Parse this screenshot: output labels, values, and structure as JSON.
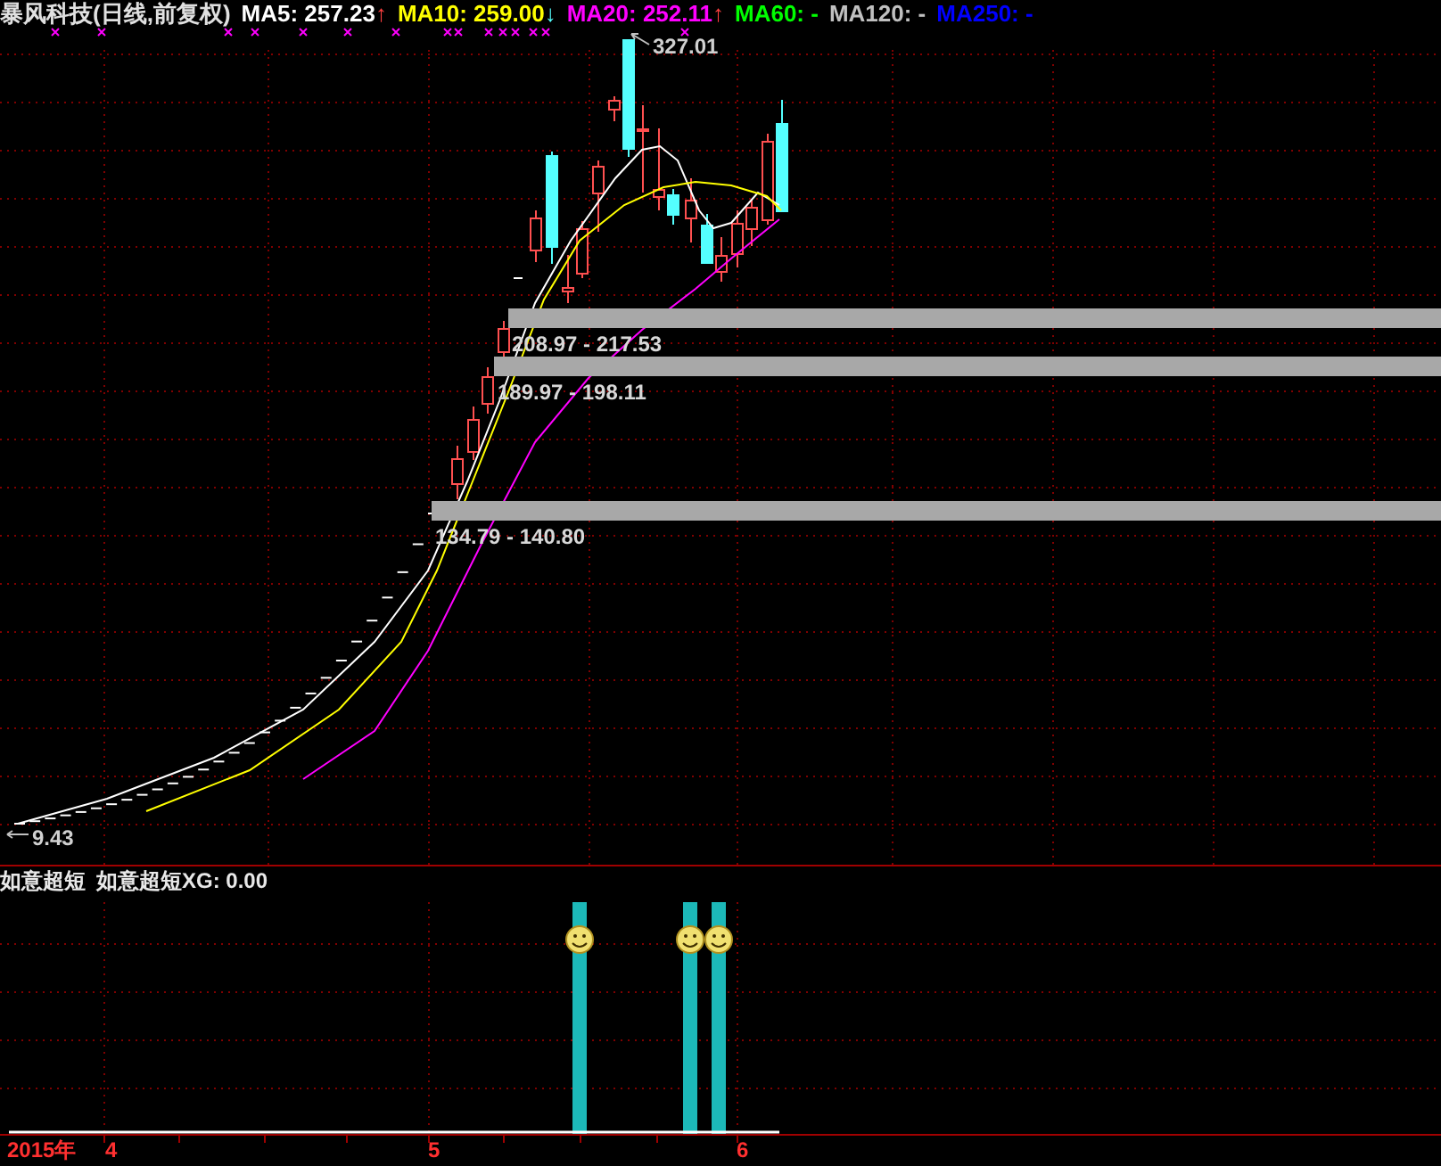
{
  "header": {
    "title": "暴风科技(日线,前复权)",
    "ma": [
      {
        "label": "MA5: 257.23",
        "color": "#ffffff",
        "arrow": {
          "text": "↑",
          "color": "#ff4040"
        }
      },
      {
        "label": "MA10: 259.00",
        "color": "#ffff00",
        "arrow": {
          "text": "↓",
          "color": "#54ffff"
        }
      },
      {
        "label": "MA20: 252.11",
        "color": "#ff00ff",
        "arrow": {
          "text": "↑",
          "color": "#ff4040"
        }
      },
      {
        "label": "MA60: -",
        "color": "#00ff00"
      },
      {
        "label": "MA120: -",
        "color": "#c0c0c0"
      },
      {
        "label": "MA250: -",
        "color": "#0000ff"
      }
    ]
  },
  "price_labels": [
    {
      "kind": "high",
      "text": "327.01"
    },
    {
      "kind": "low",
      "text": "9.43"
    }
  ],
  "zones": [
    {
      "text": "208.97 - 217.53"
    },
    {
      "text": "189.97 - 198.11"
    },
    {
      "text": "134.79 - 140.80"
    }
  ],
  "indicator": {
    "name": "如意超短",
    "value": "如意超短XG: 0.00"
  },
  "axis": {
    "year": "2015年",
    "months": [
      "4",
      "5",
      "6"
    ]
  }
}
